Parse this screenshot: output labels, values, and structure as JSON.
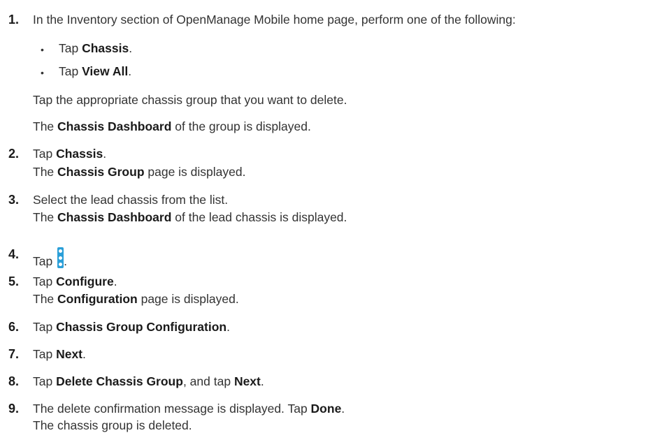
{
  "steps": [
    {
      "number": "1.",
      "intro": "In the Inventory section of OpenManage Mobile home page, perform one of the following:",
      "bullets": [
        {
          "prefix": "Tap ",
          "bold": "Chassis",
          "suffix": "."
        },
        {
          "prefix": "Tap ",
          "bold": "View All",
          "suffix": "."
        }
      ],
      "para1": "Tap the appropriate chassis group that you want to delete.",
      "para2": {
        "prefix": "The ",
        "bold": "Chassis Dashboard",
        "suffix": " of the group is displayed."
      }
    },
    {
      "number": "2.",
      "line1": {
        "prefix": "Tap ",
        "bold": "Chassis",
        "suffix": "."
      },
      "line2": {
        "prefix": "The ",
        "bold": "Chassis Group",
        "suffix": " page is displayed."
      }
    },
    {
      "number": "3.",
      "line1": "Select the lead chassis from the list.",
      "line2": {
        "prefix": "The ",
        "bold": "Chassis Dashboard",
        "suffix": " of the lead chassis is displayed."
      }
    },
    {
      "number": "4.",
      "line1": {
        "prefix": "Tap ",
        "icon": "more-options-kebab-icon",
        "suffix": "."
      }
    },
    {
      "number": "5.",
      "line1": {
        "prefix": "Tap ",
        "bold": "Configure",
        "suffix": "."
      },
      "line2": {
        "prefix": "The ",
        "bold": "Configuration",
        "suffix": " page is displayed."
      }
    },
    {
      "number": "6.",
      "line1": {
        "prefix": "Tap ",
        "bold": "Chassis Group Configuration",
        "suffix": "."
      }
    },
    {
      "number": "7.",
      "line1": {
        "prefix": "Tap ",
        "bold": "Next",
        "suffix": "."
      }
    },
    {
      "number": "8.",
      "line1": {
        "prefix": "Tap ",
        "bold": "Delete Chassis Group",
        "middle": ", and tap ",
        "bold2": "Next",
        "suffix": "."
      }
    },
    {
      "number": "9.",
      "line1": {
        "prefix": "The delete confirmation message is displayed. Tap ",
        "bold": "Done",
        "suffix": "."
      },
      "line2": "The chassis group is deleted."
    }
  ],
  "colors": {
    "text": "#333333",
    "number": "#1a1a1a",
    "icon_accent": "#2b9fd8"
  }
}
